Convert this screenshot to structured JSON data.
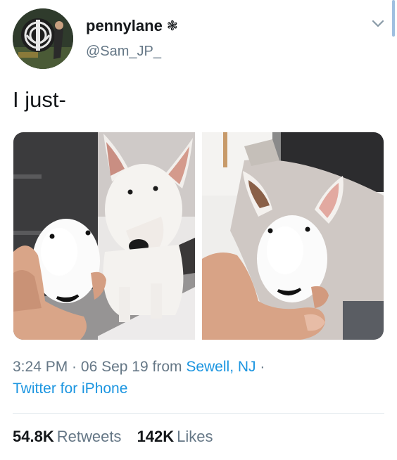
{
  "tweet": {
    "author": {
      "display_name": "pennylane",
      "badge_glyph": "❃",
      "handle": "@Sam_JP_"
    },
    "text": "I just-",
    "meta": {
      "time": "3:24 PM",
      "sep1": " · ",
      "date": "06 Sep 19",
      "from_word": " from ",
      "location": "Sewell, NJ",
      "sep2": " ·",
      "source": "Twitter for iPhone"
    },
    "stats": {
      "retweets_count": "54.8K",
      "retweets_label": "Retweets",
      "likes_count": "142K",
      "likes_label": "Likes"
    }
  },
  "colors": {
    "link": "#1b95e0",
    "secondary_text": "#657786",
    "primary_text": "#14171a",
    "divider": "#e1e8ed"
  },
  "icons": {
    "more": "chevron-down-icon",
    "badge": "flower-icon"
  }
}
